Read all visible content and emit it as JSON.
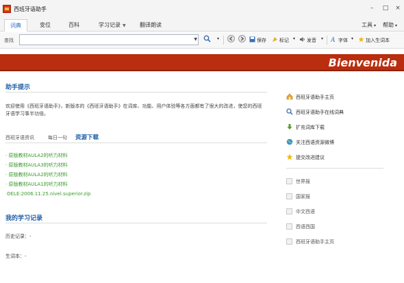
{
  "window": {
    "title": "西班牙语助手",
    "controls": {
      "minimize": "–",
      "maximize": "□",
      "close": "×"
    }
  },
  "tabs": [
    {
      "label": "词典",
      "active": true
    },
    {
      "label": "变位",
      "active": false
    },
    {
      "label": "百科",
      "active": false
    },
    {
      "label": "学习记录",
      "active": false,
      "dropdown": true
    },
    {
      "label": "翻译朗读",
      "active": false
    }
  ],
  "right_menu": {
    "tools": "工具",
    "help": "帮助"
  },
  "toolbar": {
    "search_label": "查找",
    "search_value": "",
    "save": "保存",
    "bookmark": "标记",
    "pronounce": "发音",
    "font": "字体",
    "add_vocab": "加入生词本"
  },
  "banner": {
    "text": "Bienvenida",
    "color": "#b82e0e"
  },
  "tips": {
    "title": "助手提示",
    "text": "欢迎使用《西班牙语助手》，新版本的《西班牙语助手》在词库、功能、用户体验等各方面都有了很大的改进，使您的西班牙语学习事半功倍。"
  },
  "subtabs": [
    {
      "label": "西班牙语资讯",
      "active": false
    },
    {
      "label": "每日一句",
      "active": false
    },
    {
      "label": "资源下载",
      "active": true
    }
  ],
  "downloads": [
    "· 原版教材AULA2的听力材料",
    "· 原版教材AULA3的听力材料",
    "· 原版教材AULA2的听力材料",
    "· 原版教材AULA1的听力材料",
    "·DELE:2006.11.25.nivel.superior.zip"
  ],
  "study": {
    "title": "我的学习记录",
    "history_label": "历史记录：-",
    "vocab_label": "生词本：-"
  },
  "right_links": [
    {
      "label": "西班牙语助手主页",
      "icon": "home-icon"
    },
    {
      "label": "西班牙语助手在线词典",
      "icon": "search-icon"
    },
    {
      "label": "扩充词库下载",
      "icon": "download-icon"
    },
    {
      "label": "关注西语资源微博",
      "icon": "globe-icon"
    },
    {
      "label": "提交改进建议",
      "icon": "star-icon"
    }
  ],
  "right_sites": [
    "世界报",
    "国家报",
    "中文西语",
    "西语西国",
    "西班牙语助手主页"
  ],
  "colors": {
    "accent": "#1f5fa8",
    "link_green": "#3a9a2a",
    "banner": "#b82e0e"
  }
}
